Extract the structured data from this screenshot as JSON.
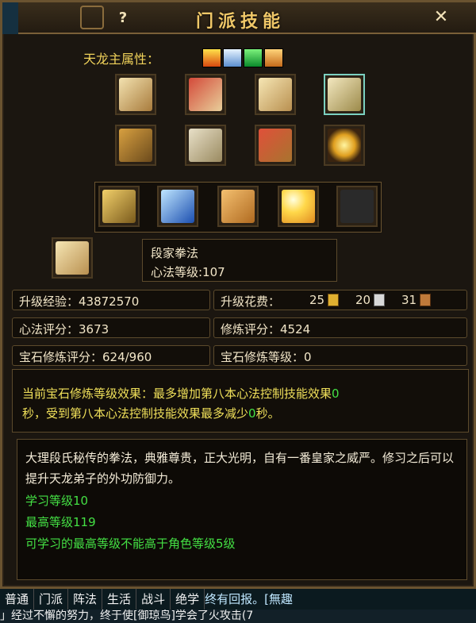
{
  "window": {
    "title": "门派技能",
    "help_label": "?",
    "close_label": "✕"
  },
  "attributes": {
    "label": "天龙主属性：",
    "icons": [
      "fire-icon",
      "ice-icon",
      "poison-icon",
      "mystic-icon"
    ]
  },
  "skill_icons": {
    "row1": [
      "scroll-icon",
      "rolled-scrolls-icon",
      "open-book-icon",
      "selected-book-icon"
    ],
    "row2": [
      "tablet-icon",
      "manual-icon",
      "red-books-icon",
      "golden-swirl-icon"
    ],
    "row3": [
      "armor-icon",
      "blue-strike-icon",
      "fist-icon",
      "sun-burst-icon",
      "empty-slot"
    ]
  },
  "selected_skill": {
    "icon": "open-book-icon",
    "name": "段家拳法",
    "level_text": "心法等级:107"
  },
  "stats": {
    "upgrade_exp": "升级经验：43872570",
    "upgrade_cost_label": "升级花费：",
    "cost_gold": "25",
    "cost_silver": "20",
    "cost_copper": "31",
    "xinfa_score": "心法评分：3673",
    "xiulian_score": "修炼评分：4524",
    "gem_score": "宝石修炼评分：624/960",
    "gem_level": "宝石修炼等级：0"
  },
  "effect": {
    "line1_a": "当前宝石修炼等级效果：最多增加第八本心法控制技能效果",
    "line1_b": "0",
    "line2_a": "秒，受到第八本心法控制技能效果最多减少",
    "line2_b": "0",
    "line2_c": "秒。"
  },
  "description": {
    "text": "大理段氏秘传的拳法，典雅尊贵，正大光明，自有一番皇家之威严。修习之后可以提升天龙弟子的外功防御力。",
    "learn_level": "学习等级10",
    "max_level": "最高等级119",
    "note": "可学习的最高等级不能高于角色等级5级"
  },
  "chat_tabs": [
    "普通",
    "门派",
    "阵法",
    "生活",
    "战斗",
    "绝学"
  ],
  "chat_line1_tail": "终有回报。[無趣",
  "chat_line2": "」经过不懈的努力，终于使[御琼鸟]学会了火攻击(7"
}
